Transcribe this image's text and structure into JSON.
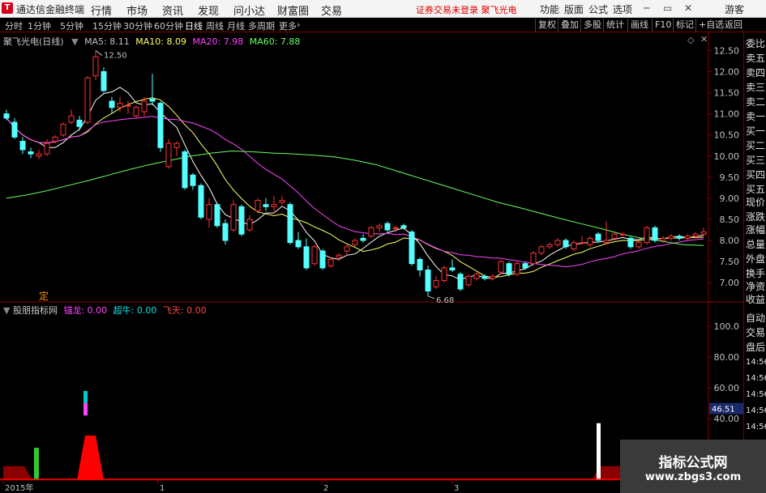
{
  "titlebar": {
    "app_name": "通达信金融终端",
    "menus": [
      "行情",
      "市场",
      "资讯",
      "发现",
      "问小达",
      "财富圈",
      "交易"
    ],
    "status": "证券交易未登录  聚飞光电",
    "right_menus": [
      "功能",
      "版面",
      "公式",
      "选项"
    ],
    "guest": "游客"
  },
  "toolbar": {
    "periods": [
      "分时",
      "1分钟",
      "5分钟",
      "15分钟",
      "30分钟",
      "60分钟",
      "日线",
      "周线",
      "月线",
      "多周期",
      "更多"
    ],
    "active_period": "日线",
    "buttons": [
      "复权",
      "叠加",
      "多股",
      "统计",
      "画线",
      "F10",
      "标记",
      "+自选",
      "返回"
    ]
  },
  "main_chart": {
    "title": "聚飞光电(日线)",
    "ma": [
      {
        "label": "MA5: 8.11",
        "color": "#ffffff"
      },
      {
        "label": "MA10: 8.09",
        "color": "#ffff66"
      },
      {
        "label": "MA20: 7.98",
        "color": "#ff44ff"
      },
      {
        "label": "MA60: 7.88",
        "color": "#66ff66"
      }
    ],
    "high_label": "12.50",
    "low_label": "6.68",
    "marker": "定",
    "y_ticks": [
      "12.50",
      "12.00",
      "11.50",
      "11.00",
      "10.50",
      "10.00",
      "9.50",
      "9.00",
      "8.50",
      "8.00",
      "7.50",
      "7.00"
    ]
  },
  "sub_chart": {
    "title": "股朋指标网",
    "items": [
      {
        "label": "锚龙: 0.00",
        "color": "#ff44ff"
      },
      {
        "label": "超牛: 0.00",
        "color": "#00e5e5"
      },
      {
        "label": "飞天: 0.00",
        "color": "#ff4444"
      }
    ],
    "y_ticks": [
      "100.0",
      "80.00",
      "60.00",
      "40.00"
    ],
    "current_value": "46.51"
  },
  "x_axis": [
    "2015年",
    "1",
    "2",
    "3"
  ],
  "sidebar": {
    "top_items": [
      "委比",
      "卖五",
      "卖四",
      "卖三",
      "卖二",
      "卖一",
      "买一",
      "买二",
      "买三",
      "买四",
      "买五",
      "现价",
      "涨跌",
      "涨幅",
      "总量",
      "外盘",
      "换手",
      "净资",
      "收益"
    ],
    "bottom_items": [
      "自动",
      "交易",
      "盘后"
    ],
    "times": [
      "14:56",
      "14:56",
      "14:56",
      "14:56",
      "14:56",
      "14:56",
      "14:56"
    ]
  },
  "watermark": {
    "line1": "指标公式网",
    "line2": "www.zbgs3.com"
  },
  "candles": [
    {
      "o": 11.0,
      "c": 10.9,
      "h": 11.1,
      "l": 10.85
    },
    {
      "o": 10.8,
      "c": 10.45,
      "h": 10.9,
      "l": 10.4
    },
    {
      "o": 10.35,
      "c": 10.15,
      "h": 10.45,
      "l": 10.05
    },
    {
      "o": 10.1,
      "c": 10.05,
      "h": 10.2,
      "l": 9.95
    },
    {
      "o": 10.0,
      "c": 10.05,
      "h": 10.15,
      "l": 9.92
    },
    {
      "o": 10.05,
      "c": 10.3,
      "h": 10.4,
      "l": 10.0
    },
    {
      "o": 10.35,
      "c": 10.45,
      "h": 10.5,
      "l": 10.3
    },
    {
      "o": 10.5,
      "c": 10.75,
      "h": 10.8,
      "l": 10.45
    },
    {
      "o": 10.8,
      "c": 10.95,
      "h": 11.1,
      "l": 10.75
    },
    {
      "o": 10.85,
      "c": 10.7,
      "h": 10.95,
      "l": 10.6
    },
    {
      "o": 10.8,
      "c": 11.85,
      "h": 11.9,
      "l": 10.75
    },
    {
      "o": 11.9,
      "c": 12.35,
      "h": 12.5,
      "l": 11.8
    },
    {
      "o": 12.0,
      "c": 11.55,
      "h": 12.1,
      "l": 11.5
    },
    {
      "o": 11.3,
      "c": 11.15,
      "h": 11.4,
      "l": 11.0
    },
    {
      "o": 11.15,
      "c": 11.25,
      "h": 11.4,
      "l": 11.05
    },
    {
      "o": 11.2,
      "c": 11.2,
      "h": 11.3,
      "l": 11.0
    },
    {
      "o": 10.95,
      "c": 11.15,
      "h": 11.2,
      "l": 10.9
    },
    {
      "o": 11.05,
      "c": 11.3,
      "h": 11.4,
      "l": 10.95
    },
    {
      "o": 11.35,
      "c": 11.3,
      "h": 11.95,
      "l": 11.2
    },
    {
      "o": 11.25,
      "c": 10.2,
      "h": 11.3,
      "l": 10.1
    },
    {
      "o": 9.75,
      "c": 10.3,
      "h": 10.4,
      "l": 9.7
    },
    {
      "o": 10.2,
      "c": 10.3,
      "h": 10.35,
      "l": 10.0
    },
    {
      "o": 10.1,
      "c": 9.25,
      "h": 10.15,
      "l": 9.2
    },
    {
      "o": 9.55,
      "c": 9.3,
      "h": 9.6,
      "l": 9.2
    },
    {
      "o": 9.3,
      "c": 8.55,
      "h": 9.35,
      "l": 8.5
    },
    {
      "o": 8.5,
      "c": 8.85,
      "h": 9.0,
      "l": 8.3
    },
    {
      "o": 8.85,
      "c": 8.35,
      "h": 8.9,
      "l": 8.3
    },
    {
      "o": 8.4,
      "c": 8.0,
      "h": 8.5,
      "l": 7.9
    },
    {
      "o": 8.25,
      "c": 8.85,
      "h": 8.95,
      "l": 8.2
    },
    {
      "o": 8.8,
      "c": 8.15,
      "h": 8.85,
      "l": 8.1
    },
    {
      "o": 8.25,
      "c": 8.5,
      "h": 8.6,
      "l": 8.2
    },
    {
      "o": 8.7,
      "c": 8.95,
      "h": 9.0,
      "l": 8.65
    },
    {
      "o": 8.85,
      "c": 8.8,
      "h": 9.0,
      "l": 8.7
    },
    {
      "o": 8.8,
      "c": 8.85,
      "h": 9.05,
      "l": 8.65
    },
    {
      "o": 8.9,
      "c": 8.95,
      "h": 9.05,
      "l": 8.85
    },
    {
      "o": 8.85,
      "c": 7.95,
      "h": 8.9,
      "l": 7.9
    },
    {
      "o": 8.0,
      "c": 7.85,
      "h": 8.2,
      "l": 7.8
    },
    {
      "o": 7.85,
      "c": 7.35,
      "h": 8.05,
      "l": 7.3
    },
    {
      "o": 7.45,
      "c": 7.85,
      "h": 7.9,
      "l": 7.4
    },
    {
      "o": 7.75,
      "c": 7.35,
      "h": 7.8,
      "l": 7.3
    },
    {
      "o": 7.4,
      "c": 7.55,
      "h": 7.6,
      "l": 7.35
    },
    {
      "o": 7.6,
      "c": 7.65,
      "h": 7.7,
      "l": 7.5
    },
    {
      "o": 7.75,
      "c": 7.85,
      "h": 7.9,
      "l": 7.65
    },
    {
      "o": 7.9,
      "c": 8.0,
      "h": 8.05,
      "l": 7.85
    },
    {
      "o": 8.05,
      "c": 8.0,
      "h": 8.15,
      "l": 7.95
    },
    {
      "o": 8.1,
      "c": 8.3,
      "h": 8.35,
      "l": 8.05
    },
    {
      "o": 8.3,
      "c": 8.35,
      "h": 8.4,
      "l": 8.2
    },
    {
      "o": 8.4,
      "c": 8.25,
      "h": 8.45,
      "l": 8.2
    },
    {
      "o": 8.3,
      "c": 8.3,
      "h": 8.35,
      "l": 8.2
    },
    {
      "o": 8.35,
      "c": 8.3,
      "h": 8.4,
      "l": 8.25
    },
    {
      "o": 8.2,
      "c": 7.45,
      "h": 8.25,
      "l": 7.4
    },
    {
      "o": 7.55,
      "c": 7.3,
      "h": 7.6,
      "l": 7.15
    },
    {
      "o": 7.3,
      "c": 6.8,
      "h": 7.4,
      "l": 6.68
    },
    {
      "o": 6.9,
      "c": 7.05,
      "h": 7.15,
      "l": 6.85
    },
    {
      "o": 7.05,
      "c": 7.35,
      "h": 7.4,
      "l": 7.0
    },
    {
      "o": 7.35,
      "c": 7.3,
      "h": 7.55,
      "l": 7.25
    },
    {
      "o": 7.2,
      "c": 6.85,
      "h": 7.25,
      "l": 6.8
    },
    {
      "o": 6.95,
      "c": 7.15,
      "h": 7.2,
      "l": 6.9
    },
    {
      "o": 7.1,
      "c": 7.2,
      "h": 7.25,
      "l": 7.05
    },
    {
      "o": 7.15,
      "c": 7.1,
      "h": 7.2,
      "l": 7.05
    },
    {
      "o": 7.1,
      "c": 7.15,
      "h": 7.2,
      "l": 7.05
    },
    {
      "o": 7.25,
      "c": 7.5,
      "h": 7.55,
      "l": 7.2
    },
    {
      "o": 7.45,
      "c": 7.2,
      "h": 7.5,
      "l": 7.15
    },
    {
      "o": 7.2,
      "c": 7.45,
      "h": 7.5,
      "l": 7.15
    },
    {
      "o": 7.45,
      "c": 7.35,
      "h": 7.5,
      "l": 7.3
    },
    {
      "o": 7.45,
      "c": 7.7,
      "h": 7.75,
      "l": 7.4
    },
    {
      "o": 7.7,
      "c": 7.85,
      "h": 7.9,
      "l": 7.65
    },
    {
      "o": 7.85,
      "c": 7.9,
      "h": 7.95,
      "l": 7.8
    },
    {
      "o": 7.9,
      "c": 8.0,
      "h": 8.05,
      "l": 7.85
    },
    {
      "o": 8.0,
      "c": 7.85,
      "h": 8.05,
      "l": 7.8
    },
    {
      "o": 7.8,
      "c": 7.95,
      "h": 8.0,
      "l": 7.75
    },
    {
      "o": 7.95,
      "c": 7.95,
      "h": 8.1,
      "l": 7.9
    },
    {
      "o": 7.9,
      "c": 8.05,
      "h": 8.1,
      "l": 7.85
    },
    {
      "o": 8.15,
      "c": 8.0,
      "h": 8.2,
      "l": 7.95
    },
    {
      "o": 7.95,
      "c": 8.0,
      "h": 8.45,
      "l": 7.9
    },
    {
      "o": 8.05,
      "c": 8.15,
      "h": 8.2,
      "l": 8.0
    },
    {
      "o": 8.15,
      "c": 8.15,
      "h": 8.2,
      "l": 8.1
    },
    {
      "o": 8.05,
      "c": 7.85,
      "h": 8.1,
      "l": 7.8
    },
    {
      "o": 7.85,
      "c": 7.95,
      "h": 8.0,
      "l": 7.8
    },
    {
      "o": 7.95,
      "c": 8.3,
      "h": 8.35,
      "l": 7.9
    },
    {
      "o": 8.3,
      "c": 8.0,
      "h": 8.35,
      "l": 7.95
    },
    {
      "o": 8.0,
      "c": 8.05,
      "h": 8.1,
      "l": 7.95
    },
    {
      "o": 8.05,
      "c": 8.1,
      "h": 8.15,
      "l": 8.0
    },
    {
      "o": 8.1,
      "c": 8.05,
      "h": 8.15,
      "l": 8.0
    },
    {
      "o": 8.05,
      "c": 8.1,
      "h": 8.15,
      "l": 8.0
    },
    {
      "o": 8.1,
      "c": 8.15,
      "h": 8.2,
      "l": 8.05
    },
    {
      "o": 8.15,
      "c": 8.2,
      "h": 8.3,
      "l": 8.1
    }
  ]
}
